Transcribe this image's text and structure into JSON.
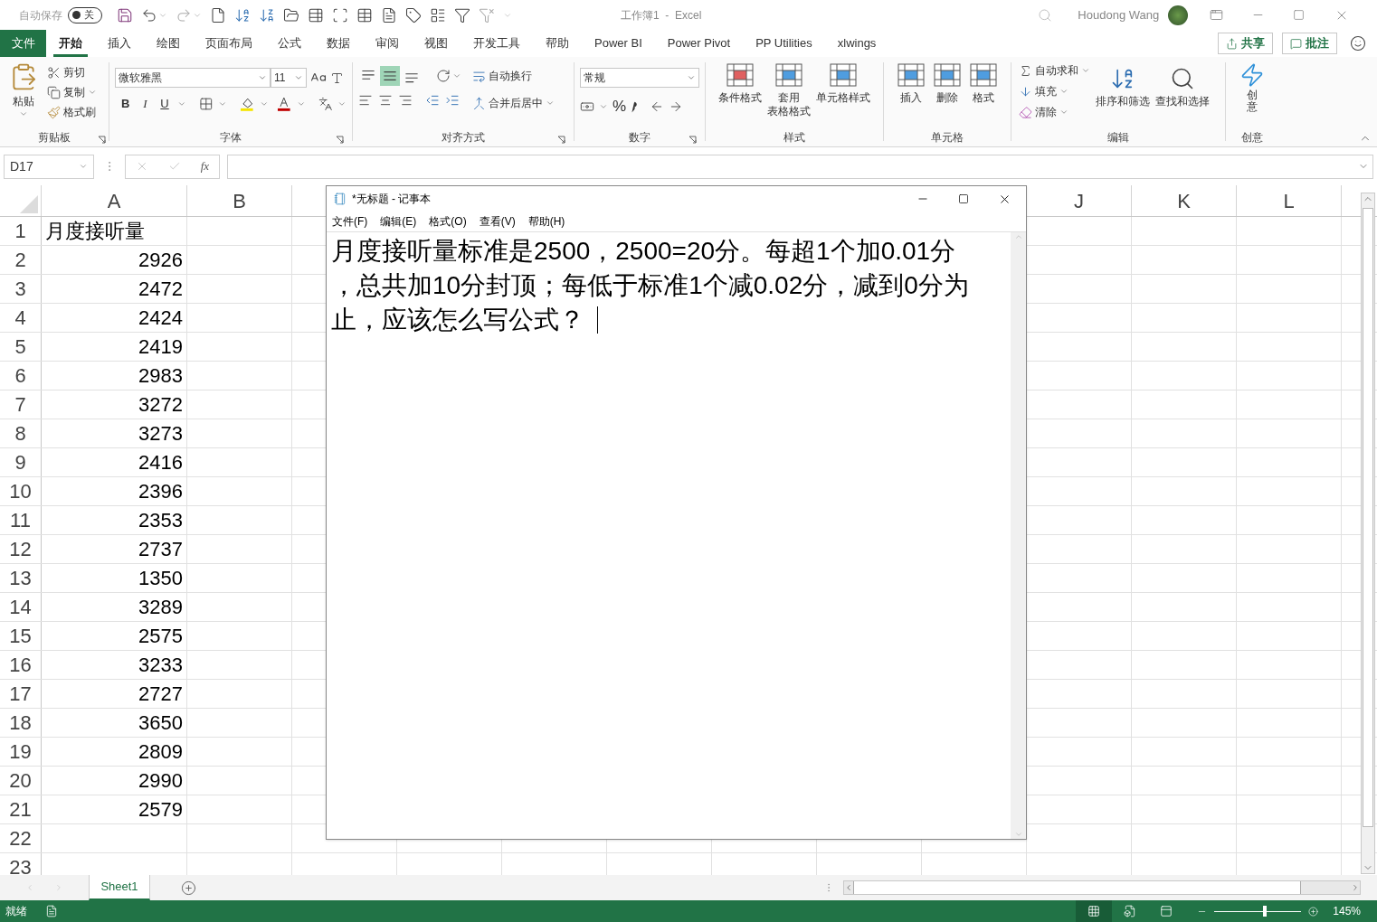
{
  "title_bar": {
    "autosave_label": "自动保存",
    "autosave_toggle": {
      "label": "关",
      "on": false
    },
    "title": "工作簿1  -  Excel",
    "user": "Houdong Wang"
  },
  "ribbon_tabs": [
    {
      "label": "文件",
      "kind": "file",
      "selected": false
    },
    {
      "label": "开始",
      "kind": "tab",
      "selected": true
    },
    {
      "label": "插入",
      "kind": "tab",
      "selected": false
    },
    {
      "label": "绘图",
      "kind": "tab",
      "selected": false
    },
    {
      "label": "页面布局",
      "kind": "tab",
      "selected": false
    },
    {
      "label": "公式",
      "kind": "tab",
      "selected": false
    },
    {
      "label": "数据",
      "kind": "tab",
      "selected": false
    },
    {
      "label": "审阅",
      "kind": "tab",
      "selected": false
    },
    {
      "label": "视图",
      "kind": "tab",
      "selected": false
    },
    {
      "label": "开发工具",
      "kind": "tab",
      "selected": false
    },
    {
      "label": "帮助",
      "kind": "tab",
      "selected": false
    },
    {
      "label": "Power BI",
      "kind": "tab",
      "selected": false
    },
    {
      "label": "Power Pivot",
      "kind": "tab",
      "selected": false
    },
    {
      "label": "PP Utilities",
      "kind": "tab",
      "selected": false
    },
    {
      "label": "xlwings",
      "kind": "tab",
      "selected": false
    }
  ],
  "share_button": "共享",
  "comment_button": "批注",
  "clipboard": {
    "paste": "粘贴",
    "cut": "剪切",
    "copy": "复制",
    "format_painter": "格式刷",
    "label": "剪贴板"
  },
  "font": {
    "name": "微软雅黑",
    "size": "11",
    "bold": "B",
    "italic": "I",
    "underline": "U",
    "label": "字体"
  },
  "alignment": {
    "vertical_align": [
      {
        "selected": false
      },
      {
        "selected": true
      },
      {
        "selected": false
      }
    ],
    "wrap": "自动换行",
    "merge": "合并后居中",
    "label": "对齐方式"
  },
  "number": {
    "format": "常规",
    "percent": "%",
    "label": "数字"
  },
  "styles": {
    "items": [
      {
        "lines": [
          "条件格式"
        ]
      },
      {
        "lines": [
          "套用",
          "表格格式"
        ]
      },
      {
        "lines": [
          "单元格样式"
        ]
      }
    ],
    "label": "样式"
  },
  "cells": {
    "items": [
      "插入",
      "删除",
      "格式"
    ],
    "label": "单元格"
  },
  "editing": {
    "autosum": "自动求和",
    "fill": "填充",
    "clear": "清除",
    "sort": "排序和筛选",
    "find": "查找和选择",
    "label": "编辑"
  },
  "ideas": {
    "button": "创意",
    "label": "创意"
  },
  "formula_bar": {
    "name_box": "D17",
    "function_label": "fx"
  },
  "sheet": {
    "columns": [
      {
        "label": "A"
      },
      {
        "label": "B"
      },
      {
        "label": "J"
      },
      {
        "label": "K"
      },
      {
        "label": "L"
      }
    ],
    "rows": [
      {
        "num": "1",
        "a": "月度接听量",
        "kind": "text"
      },
      {
        "num": "2",
        "a": "2926",
        "kind": "number"
      },
      {
        "num": "3",
        "a": "2472",
        "kind": "number"
      },
      {
        "num": "4",
        "a": "2424",
        "kind": "number"
      },
      {
        "num": "5",
        "a": "2419",
        "kind": "number"
      },
      {
        "num": "6",
        "a": "2983",
        "kind": "number"
      },
      {
        "num": "7",
        "a": "3272",
        "kind": "number"
      },
      {
        "num": "8",
        "a": "3273",
        "kind": "number"
      },
      {
        "num": "9",
        "a": "2416",
        "kind": "number"
      },
      {
        "num": "10",
        "a": "2396",
        "kind": "number"
      },
      {
        "num": "11",
        "a": "2353",
        "kind": "number"
      },
      {
        "num": "12",
        "a": "2737",
        "kind": "number"
      },
      {
        "num": "13",
        "a": "1350",
        "kind": "number"
      },
      {
        "num": "14",
        "a": "3289",
        "kind": "number"
      },
      {
        "num": "15",
        "a": "2575",
        "kind": "number"
      },
      {
        "num": "16",
        "a": "3233",
        "kind": "number"
      },
      {
        "num": "17",
        "a": "2727",
        "kind": "number"
      },
      {
        "num": "18",
        "a": "3650",
        "kind": "number"
      },
      {
        "num": "19",
        "a": "2809",
        "kind": "number"
      },
      {
        "num": "20",
        "a": "2990",
        "kind": "number"
      },
      {
        "num": "21",
        "a": "2579",
        "kind": "number"
      },
      {
        "num": "22",
        "kind": "empty"
      },
      {
        "num": "23",
        "kind": "empty"
      }
    ],
    "tab": {
      "label": "Sheet1",
      "selected": true
    }
  },
  "notepad": {
    "title": "*无标题 - 记事本",
    "menu": [
      "文件(F)",
      "编辑(E)",
      "格式(O)",
      "查看(V)",
      "帮助(H)"
    ],
    "lines": [
      "月度接听量标准是2500，2500=20分。每超1个加0.01分",
      "，总共加10分封顶；每低于标准1个减0.02分，减到0分为",
      "止，应该怎么写公式？"
    ]
  },
  "status_bar": {
    "status": "就绪",
    "views": [
      {
        "selected": true
      },
      {
        "selected": false
      },
      {
        "selected": false
      }
    ],
    "zoom": {
      "level": 0.58,
      "reading": "145%"
    }
  }
}
